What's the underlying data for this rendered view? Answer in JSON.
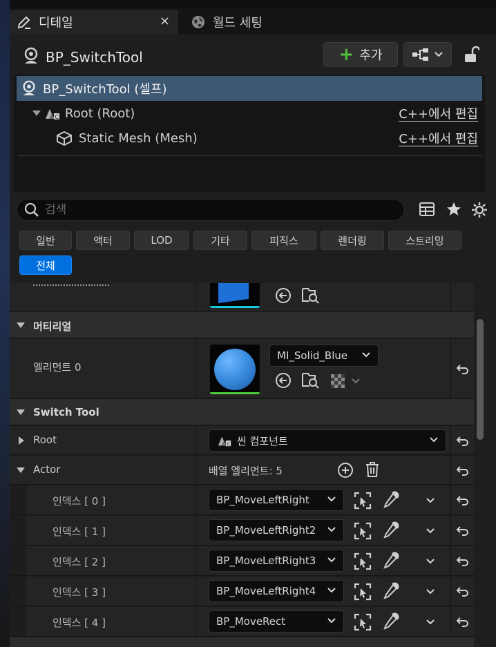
{
  "tabs": [
    {
      "label": "디테일",
      "close": "×"
    },
    {
      "label": "월드 세팅"
    }
  ],
  "header": {
    "title": "BP_SwitchTool",
    "add_label": "추가"
  },
  "tree": [
    {
      "label": "BP_SwitchTool (셀프)"
    },
    {
      "label": "Root (Root)",
      "edit": "C++에서 편집"
    },
    {
      "label": "Static Mesh (Mesh)",
      "edit": "C++에서 편집"
    }
  ],
  "search": {
    "placeholder": "검색"
  },
  "filters": [
    "일반",
    "액터",
    "LOD",
    "기타",
    "피직스",
    "렌더링",
    "스트리밍",
    "전체"
  ],
  "sections": {
    "material": {
      "title": "머티리얼",
      "element_label": "엘리먼트 0",
      "material_value": "MI_Solid_Blue"
    },
    "switch_tool": {
      "title": "Switch Tool",
      "root_label": "Root",
      "root_value": "씬 컴포넌트",
      "actor_label": "Actor",
      "array_count": "배열 엘리먼트: 5",
      "items": [
        {
          "index": "인덱스 [ 0 ]",
          "value": "BP_MoveLeftRight"
        },
        {
          "index": "인덱스 [ 1 ]",
          "value": "BP_MoveLeftRight2"
        },
        {
          "index": "인덱스 [ 2 ]",
          "value": "BP_MoveLeftRight3"
        },
        {
          "index": "인덱스 [ 3 ]",
          "value": "BP_MoveLeftRight4"
        },
        {
          "index": "인덱스 [ 4 ]",
          "value": "BP_MoveRect"
        }
      ]
    }
  },
  "colors": {
    "selected_row": "#3d5873",
    "active_filter": "#0070e0",
    "add_plus": "#4fbf3a",
    "material_sphere": "#3b8fe0"
  }
}
